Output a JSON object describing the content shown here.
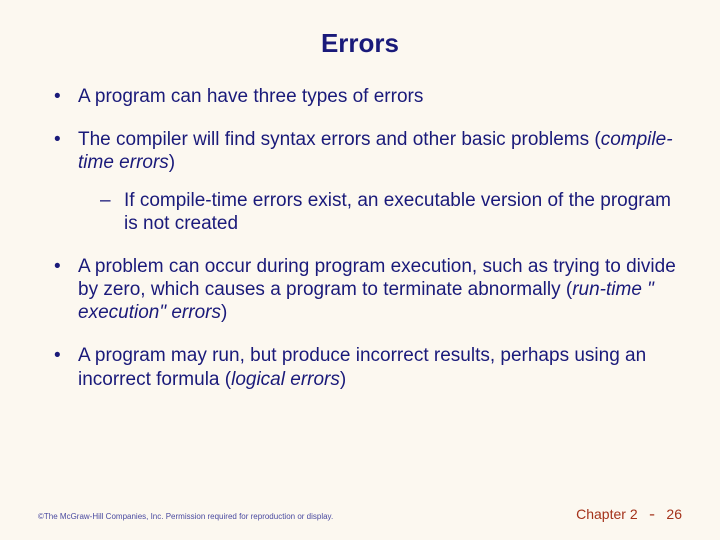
{
  "title": "Errors",
  "bullets": {
    "b1": "A program can have three types of errors",
    "b2a": "The compiler will find syntax errors and other basic problems (",
    "b2b": "compile-time errors",
    "b2c": ")",
    "s1": "If compile-time errors exist, an executable version of the program is not created",
    "b3a": "A problem can occur during program execution, such as trying to divide by zero, which causes a program to terminate abnormally (",
    "b3b": "run-time \" execution\" errors",
    "b3c": ")",
    "b4a": "A program may run, but produce incorrect results, perhaps using an incorrect formula (",
    "b4b": "logical errors",
    "b4c": ")"
  },
  "footer": {
    "copyright": "©The McGraw-Hill Companies, Inc. Permission required for reproduction or display.",
    "page_prefix": "Chapter 2",
    "page_dash": " - ",
    "page_num": "26"
  }
}
